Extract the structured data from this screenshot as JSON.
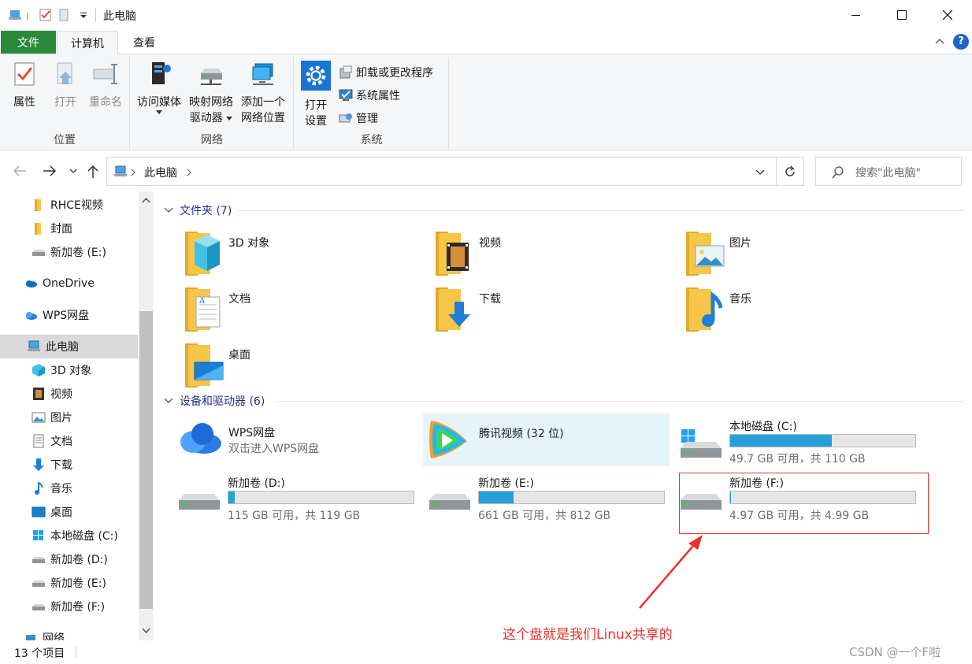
{
  "window": {
    "title": "此电脑"
  },
  "ribbon_tabs": {
    "file": "文件",
    "computer": "计算机",
    "view": "查看"
  },
  "ribbon": {
    "location": {
      "label": "位置",
      "properties": "属性",
      "open": "打开",
      "rename": "重命名"
    },
    "network": {
      "label": "网络",
      "access_media": "访问媒体",
      "map_drive_1": "映射网络",
      "map_drive_2": "驱动器",
      "add_location_1": "添加一个",
      "add_location_2": "网络位置"
    },
    "system": {
      "label": "系统",
      "open_settings_1": "打开",
      "open_settings_2": "设置",
      "uninstall": "卸载或更改程序",
      "system_properties": "系统属性",
      "manage": "管理"
    }
  },
  "address": {
    "path": "此电脑",
    "search_placeholder": "搜索\"此电脑\""
  },
  "nav": {
    "items": [
      {
        "label": "RHCE视频",
        "icon": "folder-icon"
      },
      {
        "label": "封面",
        "icon": "folder-icon"
      },
      {
        "label": "新加卷 (E:)",
        "icon": "drive-icon"
      },
      {
        "label": "OneDrive",
        "icon": "cloud-icon"
      },
      {
        "label": "WPS网盘",
        "icon": "wps-cloud-icon"
      },
      {
        "label": "此电脑",
        "icon": "computer-icon"
      },
      {
        "label": "3D 对象",
        "icon": "cube-icon"
      },
      {
        "label": "视频",
        "icon": "video-icon"
      },
      {
        "label": "图片",
        "icon": "picture-icon"
      },
      {
        "label": "文档",
        "icon": "document-icon"
      },
      {
        "label": "下载",
        "icon": "download-icon"
      },
      {
        "label": "音乐",
        "icon": "music-icon"
      },
      {
        "label": "桌面",
        "icon": "desktop-icon"
      },
      {
        "label": "本地磁盘 (C:)",
        "icon": "windows-drive-icon"
      },
      {
        "label": "新加卷 (D:)",
        "icon": "drive-icon"
      },
      {
        "label": "新加卷 (E:)",
        "icon": "drive-icon"
      },
      {
        "label": "新加卷 (F:)",
        "icon": "drive-icon"
      },
      {
        "label": "网络",
        "icon": "network-icon"
      }
    ]
  },
  "folders": {
    "header": "文件夹 (7)",
    "items": [
      {
        "name": "3D 对象"
      },
      {
        "name": "视频"
      },
      {
        "name": "图片"
      },
      {
        "name": "文档"
      },
      {
        "name": "下载"
      },
      {
        "name": "音乐"
      },
      {
        "name": "桌面"
      }
    ]
  },
  "devices": {
    "header": "设备和驱动器 (6)",
    "wps": {
      "name": "WPS网盘",
      "sub": "双击进入WPS网盘"
    },
    "tencent": {
      "name": "腾讯视频 (32 位)"
    },
    "drives": [
      {
        "name": "本地磁盘 (C:)",
        "info": "49.7 GB 可用，共 110 GB",
        "used_fraction": 0.548
      },
      {
        "name": "新加卷 (D:)",
        "info": "115 GB 可用，共 119 GB",
        "used_fraction": 0.034
      },
      {
        "name": "新加卷 (E:)",
        "info": "661 GB 可用，共 812 GB",
        "used_fraction": 0.186
      },
      {
        "name": "新加卷 (F:)",
        "info": "4.97 GB 可用，共 4.99 GB",
        "used_fraction": 0.004
      }
    ]
  },
  "annotation": {
    "text": "这个盘就是我们Linux共享的",
    "color": "#e8322c"
  },
  "status": {
    "count": "13 个项目"
  },
  "watermark": "CSDN @一个F啦"
}
